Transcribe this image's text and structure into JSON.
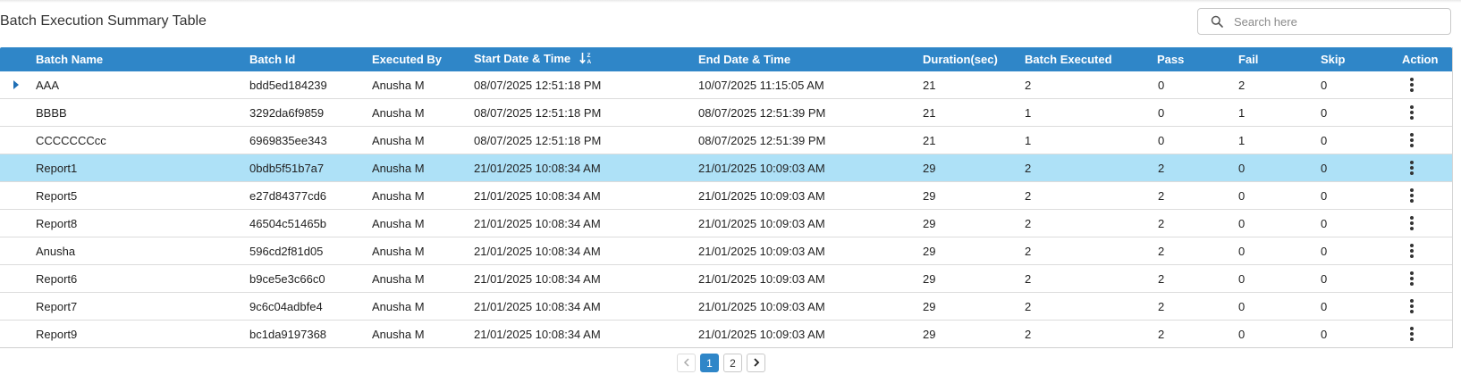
{
  "title": "Batch Execution Summary Table",
  "search": {
    "placeholder": "Search here"
  },
  "columns": {
    "name": "Batch Name",
    "id": "Batch Id",
    "by": "Executed By",
    "start": "Start Date & Time",
    "end": "End Date & Time",
    "duration": "Duration(sec)",
    "executed": "Batch Executed",
    "pass": "Pass",
    "fail": "Fail",
    "skip": "Skip",
    "action": "Action"
  },
  "rows": [
    {
      "name": "AAA",
      "id": "bdd5ed184239",
      "by": "Anusha M",
      "start": "08/07/2025 12:51:18 PM",
      "end": "10/07/2025 11:15:05 AM",
      "duration": "21",
      "executed": "2",
      "pass": "0",
      "fail": "2",
      "skip": "0"
    },
    {
      "name": "BBBB",
      "id": "3292da6f9859",
      "by": "Anusha M",
      "start": "08/07/2025 12:51:18 PM",
      "end": "08/07/2025 12:51:39 PM",
      "duration": "21",
      "executed": "1",
      "pass": "0",
      "fail": "1",
      "skip": "0"
    },
    {
      "name": "CCCCCCCcc",
      "id": "6969835ee343",
      "by": "Anusha M",
      "start": "08/07/2025 12:51:18 PM",
      "end": "08/07/2025 12:51:39 PM",
      "duration": "21",
      "executed": "1",
      "pass": "0",
      "fail": "1",
      "skip": "0"
    },
    {
      "name": "Report1",
      "id": "0bdb5f51b7a7",
      "by": "Anusha M",
      "start": "21/01/2025 10:08:34 AM",
      "end": "21/01/2025 10:09:03 AM",
      "duration": "29",
      "executed": "2",
      "pass": "2",
      "fail": "0",
      "skip": "0"
    },
    {
      "name": "Report5",
      "id": "e27d84377cd6",
      "by": "Anusha M",
      "start": "21/01/2025 10:08:34 AM",
      "end": "21/01/2025 10:09:03 AM",
      "duration": "29",
      "executed": "2",
      "pass": "2",
      "fail": "0",
      "skip": "0"
    },
    {
      "name": "Report8",
      "id": "46504c51465b",
      "by": "Anusha M",
      "start": "21/01/2025 10:08:34 AM",
      "end": "21/01/2025 10:09:03 AM",
      "duration": "29",
      "executed": "2",
      "pass": "2",
      "fail": "0",
      "skip": "0"
    },
    {
      "name": "Anusha",
      "id": "596cd2f81d05",
      "by": "Anusha M",
      "start": "21/01/2025 10:08:34 AM",
      "end": "21/01/2025 10:09:03 AM",
      "duration": "29",
      "executed": "2",
      "pass": "2",
      "fail": "0",
      "skip": "0"
    },
    {
      "name": "Report6",
      "id": "b9ce5e3c66c0",
      "by": "Anusha M",
      "start": "21/01/2025 10:08:34 AM",
      "end": "21/01/2025 10:09:03 AM",
      "duration": "29",
      "executed": "2",
      "pass": "2",
      "fail": "0",
      "skip": "0"
    },
    {
      "name": "Report7",
      "id": "9c6c04adbfe4",
      "by": "Anusha M",
      "start": "21/01/2025 10:08:34 AM",
      "end": "21/01/2025 10:09:03 AM",
      "duration": "29",
      "executed": "2",
      "pass": "2",
      "fail": "0",
      "skip": "0"
    },
    {
      "name": "Report9",
      "id": "bc1da9197368",
      "by": "Anusha M",
      "start": "21/01/2025 10:08:34 AM",
      "end": "21/01/2025 10:09:03 AM",
      "duration": "29",
      "executed": "2",
      "pass": "2",
      "fail": "0",
      "skip": "0"
    }
  ],
  "selected_row_index": 3,
  "icons": {
    "search": "search-icon",
    "sort": "sort-alpha-icon",
    "expand": "caret-right-icon",
    "row_action": "kebab-menu-icon",
    "prev": "chevron-left-icon",
    "next": "chevron-right-icon"
  },
  "colors": {
    "header_bg": "#2f86c8",
    "selected_row_bg": "#aee1f7",
    "active_page_bg": "#2f86c8"
  },
  "pagination": {
    "pages": [
      "1",
      "2"
    ],
    "current": "1"
  }
}
